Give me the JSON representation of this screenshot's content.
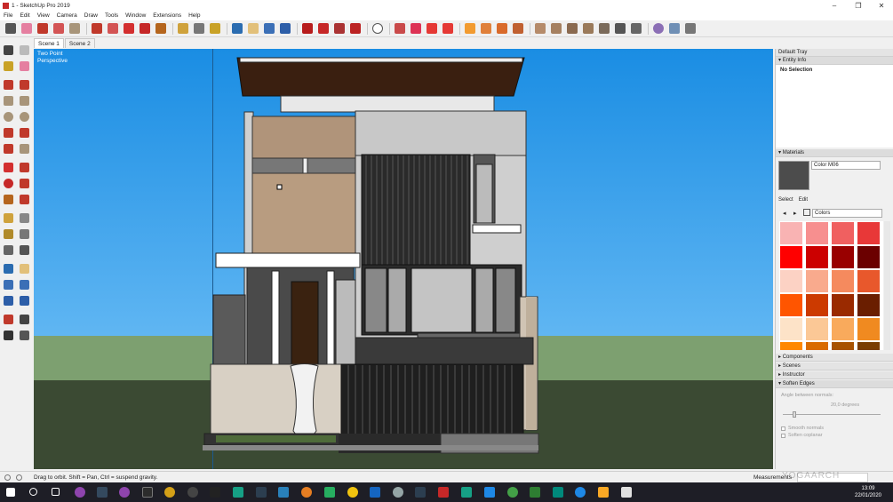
{
  "window": {
    "title": "1 - SketchUp Pro 2019",
    "controls": [
      "–",
      "❐",
      "✕"
    ]
  },
  "menu": [
    "File",
    "Edit",
    "View",
    "Camera",
    "Draw",
    "Tools",
    "Window",
    "Extensions",
    "Help"
  ],
  "scene_tabs": [
    "Scene 1",
    "Scene 2"
  ],
  "viewport": {
    "camera_line1": "Two Point",
    "camera_line2": "Perspective"
  },
  "tray": {
    "title": "Default Tray",
    "entity_info": {
      "header": "Entity Info",
      "selection": "No Selection"
    },
    "materials": {
      "header": "Materials",
      "name": "Color M06",
      "tab_select": "Select",
      "tab_edit": "Edit",
      "library": "Colors",
      "swatch_color": "#4c4c4c",
      "palette": [
        "#f9b3b3",
        "#f78f8f",
        "#f06060",
        "#e83838",
        "#ff0000",
        "#cc0000",
        "#990000",
        "#6b0000",
        "#fcd2c4",
        "#f9aa8d",
        "#f58a5e",
        "#e8582c",
        "#ff5500",
        "#cc3a00",
        "#9a2a00",
        "#6a1e00",
        "#fde3c8",
        "#fbc896",
        "#f9aa5c",
        "#f08a20",
        "#ff8800",
        "#d96b00",
        "#a85200",
        "#7a3c00"
      ]
    },
    "collapsed": [
      "Components",
      "Scenes",
      "Instructor"
    ],
    "soft_edges": {
      "header": "Soft‍en Edges",
      "angle_label": "Angle between normals:",
      "angle_value": "20,0  degrees",
      "smooth_normals": "Smooth normals",
      "soften_coplanar": "Soften coplanar"
    }
  },
  "status": {
    "message": "Drag to orbit.  Shift = Pan, Ctrl = suspend gravity.",
    "measurements_label": "Measurements"
  },
  "taskbar": {
    "time": "13:09",
    "date": "22/01/2020"
  },
  "watermark": "YOGAARCH"
}
